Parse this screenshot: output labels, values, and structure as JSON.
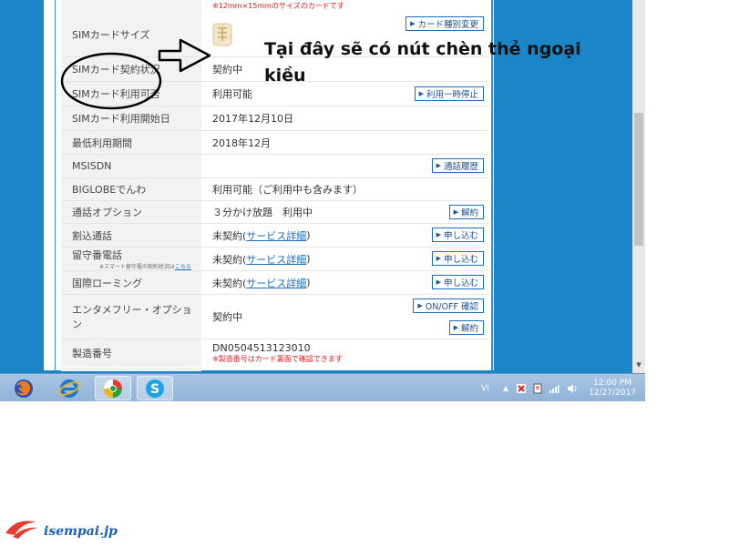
{
  "top_note": "※12mm×15mmのサイズのカードです",
  "rows": [
    {
      "label": "SIMカードサイズ",
      "value": "",
      "button": "カード種別変更"
    },
    {
      "label": "SIMカード契約状況",
      "value": "契約中"
    },
    {
      "label": "SIMカード利用可否",
      "value": "利用可能",
      "button": "利用一時停止"
    },
    {
      "label": "SIMカード利用開始日",
      "value": "2017年12月10日"
    },
    {
      "label": "最低利用期間",
      "value": "2018年12月"
    },
    {
      "label": "MSISDN",
      "value": "",
      "button": "通話履歴"
    },
    {
      "label": "BIGLOBEでんわ",
      "value": "利用可能（ご利用中も含みます）"
    },
    {
      "label": "通話オプション",
      "value": "３分かけ放題　利用中",
      "button": "解約"
    },
    {
      "label": "割込通話",
      "value": "未契約(",
      "link": "サービス詳細",
      "value_after": ")",
      "button": "申し込む"
    },
    {
      "label": "留守番電話",
      "sublabel": "※スマート留守電の契約状況は",
      "sublink": "こちら",
      "value": "未契約(",
      "link": "サービス詳細",
      "value_after": ")",
      "button": "申し込む"
    },
    {
      "label": "国際ローミング",
      "value": "未契約(",
      "link": "サービス詳細",
      "value_after": ")",
      "button": "申し込む"
    },
    {
      "label": "エンタメフリー・オプション",
      "value": "契約中",
      "button": "ON/OFF 確認",
      "button2": "解約"
    },
    {
      "label": "製造番号",
      "value": "DN0504513123010",
      "note": "※製造番号はカード裏面で確認できます"
    }
  ],
  "annotation": {
    "text_line1": "Tại đây sẽ có nút chèn thẻ ngoại",
    "text_line2": "kiều"
  },
  "taskbar": {
    "apps": [
      "firefox-icon",
      "ie-icon",
      "app-icon",
      "skype-icon"
    ],
    "lang": "VI",
    "time": "12:00 PM",
    "date": "12/27/2017"
  },
  "logo": {
    "text": "isempai.jp"
  },
  "colors": {
    "accent": "#1a86c8",
    "button_border": "#1a6fc0",
    "note_red": "#e02020"
  }
}
